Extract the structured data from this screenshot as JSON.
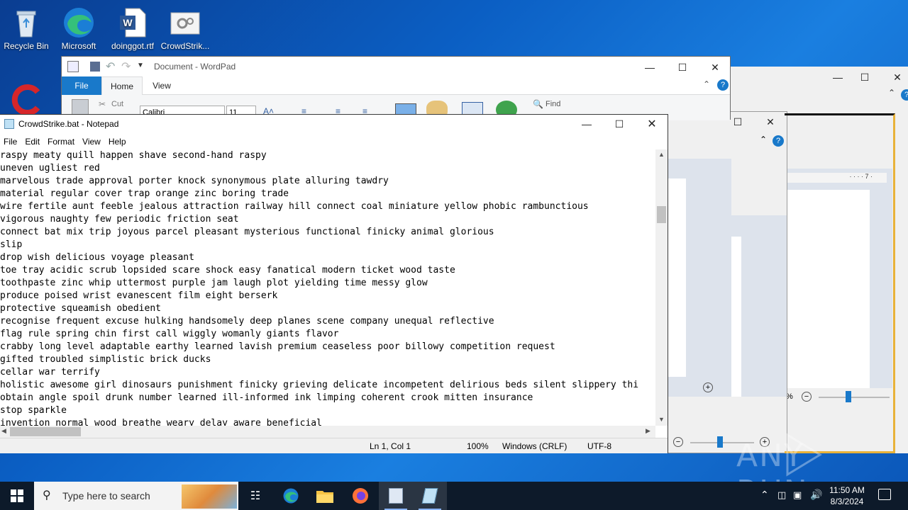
{
  "desktop": {
    "icons": [
      {
        "label": "Recycle Bin"
      },
      {
        "label": "Microsoft Ed..."
      },
      {
        "label": "doinggot.rtf"
      },
      {
        "label": "CrowdStrik..."
      },
      {
        "label": ""
      }
    ]
  },
  "wordpad": {
    "title": "Document - WordPad",
    "tabs": {
      "file": "File",
      "home": "Home",
      "view": "View"
    },
    "ribbon": {
      "cut": "Cut",
      "font": "Calibri",
      "size": "11",
      "find": "Find"
    }
  },
  "notepad": {
    "title": "CrowdStrike.bat - Notepad",
    "menu": [
      "File",
      "Edit",
      "Format",
      "View",
      "Help"
    ],
    "lines": [
      "raspy meaty quill happen shave second-hand raspy",
      "uneven ugliest red",
      "marvelous trade approval porter knock synonymous plate alluring tawdry",
      "material regular cover trap orange zinc boring trade",
      "wire fertile aunt feeble jealous attraction railway hill connect coal miniature yellow phobic rambunctious",
      "vigorous naughty few periodic friction seat",
      "connect bat mix trip joyous parcel pleasant mysterious functional finicky animal glorious",
      "slip",
      "drop wish delicious voyage pleasant",
      "toe tray acidic scrub lopsided scare shock easy fanatical modern ticket wood taste",
      "toothpaste zinc whip uttermost purple jam laugh plot yielding time messy glow",
      "produce poised wrist evanescent film eight berserk",
      "protective squeamish obedient",
      "recognise frequent excuse hulking handsomely deep planes scene company unequal reflective",
      "flag rule spring chin first call wiggly womanly giants flavor",
      "crabby long level adaptable earthy learned lavish premium ceaseless poor billowy competition request",
      "gifted troubled simplistic brick ducks",
      "cellar war terrify",
      "holistic awesome girl dinosaurs punishment finicky grieving delicate incompetent delirious beds silent slippery thi",
      "obtain angle spoil drunk number learned ill-informed ink limping coherent crook mitten insurance",
      "stop sparkle",
      "invention normal wood breathe weary delay aware beneficial"
    ],
    "status": {
      "position": "Ln 1, Col 1",
      "zoom": "100%",
      "line_ending": "Windows (CRLF)",
      "encoding": "UTF-8"
    }
  },
  "bg_window": {
    "zoom_label": "%"
  },
  "taskbar": {
    "search_placeholder": "Type here to search",
    "time": "11:50 AM",
    "date": "8/3/2024"
  },
  "watermark": {
    "text": "ANY RUN"
  },
  "colors": {
    "accent": "#1979ca",
    "taskbar": "#0d1a2a"
  }
}
